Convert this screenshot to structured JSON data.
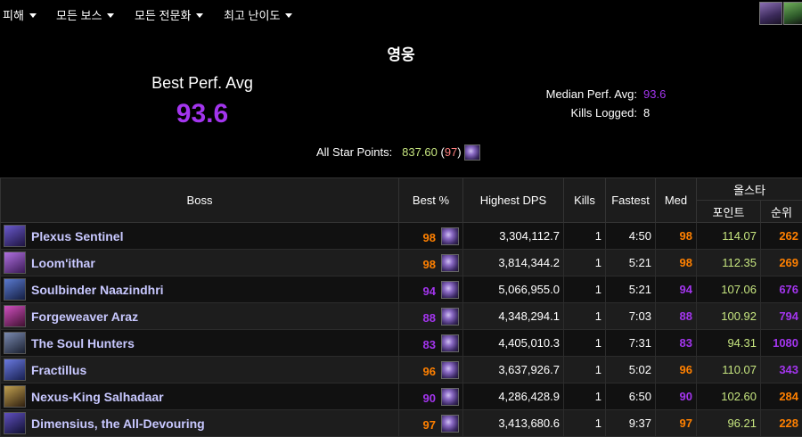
{
  "topbar": {
    "menus": [
      {
        "label": "피해"
      },
      {
        "label": "모든 보스"
      },
      {
        "label": "모든 전문화"
      },
      {
        "label": "최고 난이도"
      }
    ],
    "icons": [
      "raid-icon",
      "key-icon"
    ]
  },
  "summary": {
    "difficulty": "영웅",
    "best_perf_label": "Best Perf. Avg",
    "best_perf_value": "93.6",
    "median_label": "Median Perf. Avg:",
    "median_value": "93.6",
    "kills_label": "Kills Logged:",
    "kills_value": "8",
    "allstar_label": "All Star Points:",
    "allstar_points": "837.60",
    "allstar_rank": "97"
  },
  "table": {
    "headers": {
      "boss": "Boss",
      "best": "Best %",
      "dps": "Highest DPS",
      "kills": "Kills",
      "fastest": "Fastest",
      "med": "Med",
      "allstar_group": "올스타",
      "points": "포인트",
      "rank": "순위"
    },
    "rows": [
      {
        "boss": "Plexus Sentinel",
        "best": "98",
        "dps": "3,304,112.7",
        "kills": "1",
        "fastest": "4:50",
        "med": "98",
        "points": "114.07",
        "rank": "262",
        "best_color": "#ff8000",
        "med_color": "#ff8000",
        "rank_color": "#ff8000",
        "icon_colors": [
          "#6a5acd",
          "#1e1440"
        ]
      },
      {
        "boss": "Loom'ithar",
        "best": "98",
        "dps": "3,814,344.2",
        "kills": "1",
        "fastest": "5:21",
        "med": "98",
        "points": "112.35",
        "rank": "269",
        "best_color": "#ff8000",
        "med_color": "#ff8000",
        "rank_color": "#ff8000",
        "icon_colors": [
          "#b070e0",
          "#3a1a55"
        ]
      },
      {
        "boss": "Soulbinder Naazindhri",
        "best": "94",
        "dps": "5,066,955.0",
        "kills": "1",
        "fastest": "5:21",
        "med": "94",
        "points": "107.06",
        "rank": "676",
        "best_color": "#a335ee",
        "med_color": "#a335ee",
        "rank_color": "#a335ee",
        "icon_colors": [
          "#5a7ad0",
          "#141e40"
        ]
      },
      {
        "boss": "Forgeweaver Araz",
        "best": "88",
        "dps": "4,348,294.1",
        "kills": "1",
        "fastest": "7:03",
        "med": "88",
        "points": "100.92",
        "rank": "794",
        "best_color": "#a335ee",
        "med_color": "#a335ee",
        "rank_color": "#a335ee",
        "icon_colors": [
          "#d050c0",
          "#401030"
        ]
      },
      {
        "boss": "The Soul Hunters",
        "best": "83",
        "dps": "4,405,010.3",
        "kills": "1",
        "fastest": "7:31",
        "med": "83",
        "points": "94.31",
        "rank": "1080",
        "best_color": "#a335ee",
        "med_color": "#a335ee",
        "rank_color": "#a335ee",
        "icon_colors": [
          "#7a8ab0",
          "#1a2030"
        ]
      },
      {
        "boss": "Fractillus",
        "best": "96",
        "dps": "3,637,926.7",
        "kills": "1",
        "fastest": "5:02",
        "med": "96",
        "points": "110.07",
        "rank": "343",
        "best_color": "#ff8000",
        "med_color": "#ff8000",
        "rank_color": "#a335ee",
        "icon_colors": [
          "#6a7ae0",
          "#182050"
        ]
      },
      {
        "boss": "Nexus-King Salhadaar",
        "best": "90",
        "dps": "4,286,428.9",
        "kills": "1",
        "fastest": "6:50",
        "med": "90",
        "points": "102.60",
        "rank": "284",
        "best_color": "#a335ee",
        "med_color": "#a335ee",
        "rank_color": "#ff8000",
        "icon_colors": [
          "#c0a050",
          "#302010"
        ]
      },
      {
        "boss": "Dimensius, the All-Devouring",
        "best": "97",
        "dps": "3,413,680.6",
        "kills": "1",
        "fastest": "9:37",
        "med": "97",
        "points": "96.21",
        "rank": "228",
        "best_color": "#ff8000",
        "med_color": "#ff8000",
        "rank_color": "#ff8000",
        "icon_colors": [
          "#6050c0",
          "#101030"
        ]
      }
    ]
  },
  "colors": {
    "legendary": "#ff8000",
    "epic": "#a335ee",
    "points": "#c6e57f",
    "boss_name": "#c8c8ff"
  }
}
